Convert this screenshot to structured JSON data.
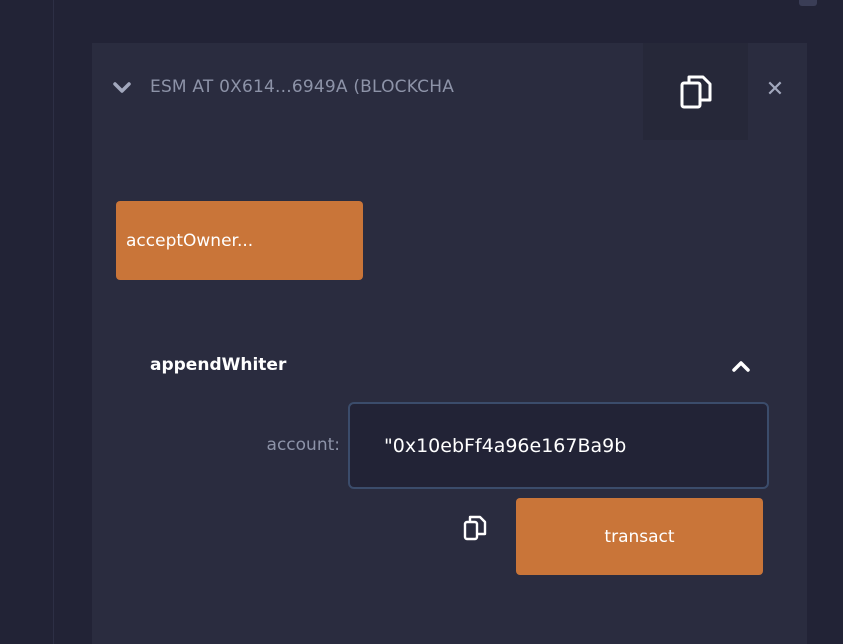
{
  "colors": {
    "background": "#222336",
    "card": "#2a2c3f",
    "accent": "#c97539",
    "muted_text": "#8d93a8",
    "input_border": "#3b4c6b"
  },
  "instance": {
    "title": "ESM AT 0X614...6949A (BLOCKCHA",
    "expand_icon": "chevron-down-icon",
    "copy_icon": "copy-icon",
    "close_icon": "close-icon"
  },
  "functions": {
    "accept_owner_label": "acceptOwner...",
    "append_whiter": {
      "name": "appendWhiter",
      "collapse_icon": "chevron-up-icon",
      "param_label": "account:",
      "param_value": "\"0x10ebFf4a96e167Ba9b",
      "copy_icon": "copy-icon",
      "transact_label": "transact"
    }
  }
}
